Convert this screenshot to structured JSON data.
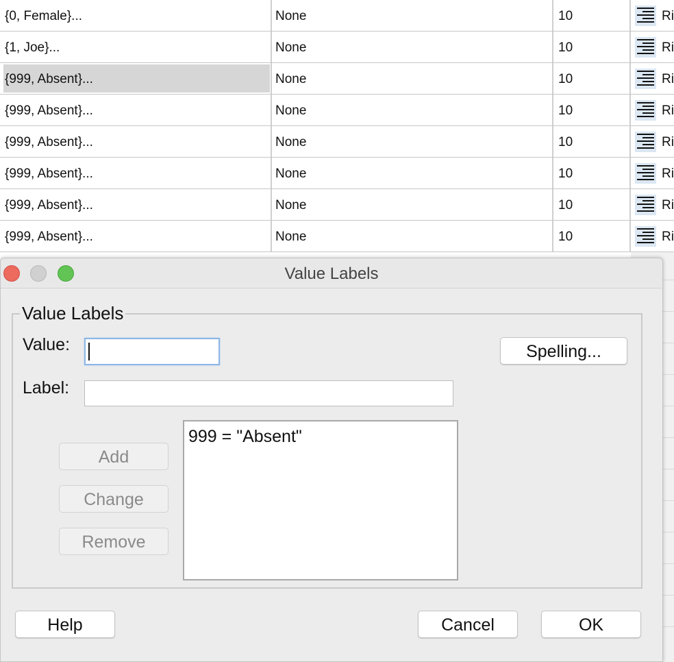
{
  "grid": {
    "rows": [
      {
        "values": "{0, Female}...",
        "missing": "None",
        "columns": "10",
        "align": "Ri",
        "selected": false
      },
      {
        "values": "{1, Joe}...",
        "missing": "None",
        "columns": "10",
        "align": "Ri",
        "selected": false
      },
      {
        "values": "{999, Absent}...",
        "missing": "None",
        "columns": "10",
        "align": "Ri",
        "selected": true
      },
      {
        "values": "{999, Absent}...",
        "missing": "None",
        "columns": "10",
        "align": "Ri",
        "selected": false
      },
      {
        "values": "{999, Absent}...",
        "missing": "None",
        "columns": "10",
        "align": "Ri",
        "selected": false
      },
      {
        "values": "{999, Absent}...",
        "missing": "None",
        "columns": "10",
        "align": "Ri",
        "selected": false
      },
      {
        "values": "{999, Absent}...",
        "missing": "None",
        "columns": "10",
        "align": "Ri",
        "selected": false
      },
      {
        "values": "{999, Absent}...",
        "missing": "None",
        "columns": "10",
        "align": "Ri",
        "selected": false
      }
    ],
    "align_icon": "align-right-icon"
  },
  "dialog": {
    "title": "Value Labels",
    "group_title": "Value Labels",
    "value_label": "Value:",
    "value_text": "",
    "label_label": "Label:",
    "label_text": "",
    "spelling_button": "Spelling...",
    "add_button": "Add",
    "change_button": "Change",
    "remove_button": "Remove",
    "list_items": [
      "999 = \"Absent\""
    ],
    "help_button": "Help",
    "cancel_button": "Cancel",
    "ok_button": "OK",
    "accent_focus": "#8db6e6",
    "close_color": "#ed6a5e",
    "maximize_color": "#61c454"
  }
}
